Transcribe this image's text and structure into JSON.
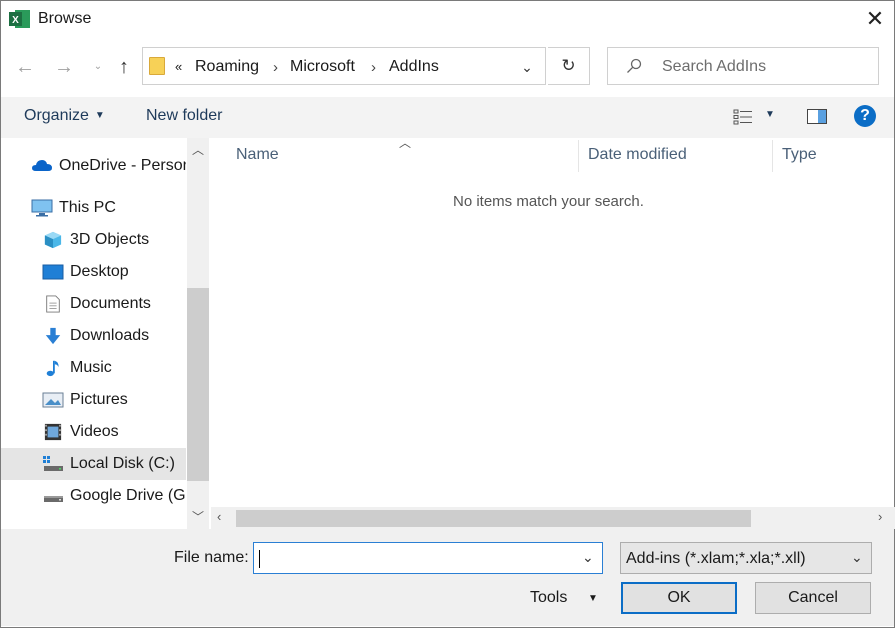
{
  "window": {
    "title": "Browse"
  },
  "nav": {
    "path": [
      "Roaming",
      "Microsoft",
      "AddIns"
    ],
    "overflow_glyph": "«"
  },
  "search": {
    "placeholder": "Search AddIns"
  },
  "toolbar": {
    "organize": "Organize",
    "new_folder": "New folder",
    "help": "?"
  },
  "sidebar": {
    "items": [
      {
        "label": "OneDrive - Person",
        "icon": "onedrive-icon",
        "level": 0
      },
      {
        "label": "This PC",
        "icon": "this-pc-icon",
        "level": 0
      },
      {
        "label": "3D Objects",
        "icon": "3d-objects-icon",
        "level": 1
      },
      {
        "label": "Desktop",
        "icon": "desktop-icon",
        "level": 1
      },
      {
        "label": "Documents",
        "icon": "documents-icon",
        "level": 1
      },
      {
        "label": "Downloads",
        "icon": "downloads-icon",
        "level": 1
      },
      {
        "label": "Music",
        "icon": "music-icon",
        "level": 1
      },
      {
        "label": "Pictures",
        "icon": "pictures-icon",
        "level": 1
      },
      {
        "label": "Videos",
        "icon": "videos-icon",
        "level": 1
      },
      {
        "label": "Local Disk (C:)",
        "icon": "local-disk-icon",
        "level": 1,
        "selected": true
      },
      {
        "label": "Google Drive (G:",
        "icon": "google-drive-icon",
        "level": 1
      }
    ]
  },
  "filelist": {
    "columns": [
      "Name",
      "Date modified",
      "Type"
    ],
    "empty_message": "No items match your search."
  },
  "footer": {
    "file_name_label": "File name:",
    "file_name_value": "",
    "filter": "Add-ins (*.xlam;*.xla;*.xll)",
    "tools": "Tools",
    "ok": "OK",
    "cancel": "Cancel"
  },
  "colors": {
    "accent": "#0b6dc6",
    "excel": "#1d6f42",
    "selected": "#e5e5e5"
  }
}
